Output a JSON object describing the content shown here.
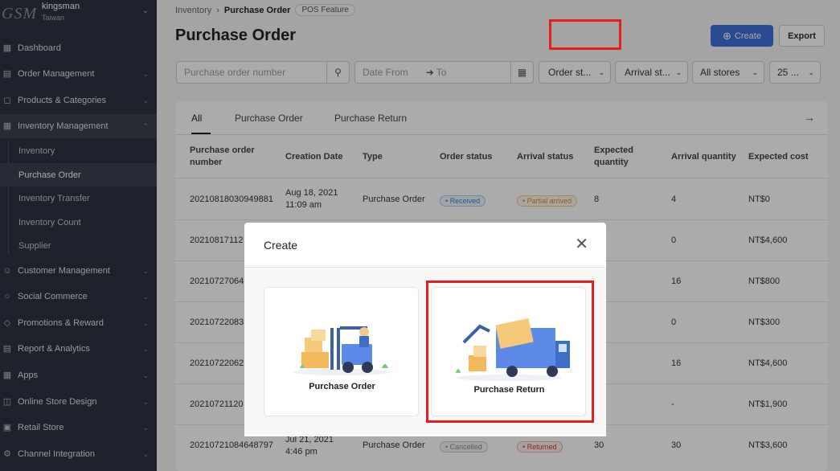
{
  "sidebar": {
    "logo": "GSM",
    "store_name": "kingsman",
    "region": "Taiwan",
    "items": [
      {
        "label": "Dashboard",
        "icon": "dashboard-icon"
      },
      {
        "label": "Order Management",
        "icon": "order-icon"
      },
      {
        "label": "Products & Categories",
        "icon": "product-icon"
      },
      {
        "label": "Inventory Management",
        "icon": "inventory-icon"
      },
      {
        "label": "Customer Management",
        "icon": "customer-icon"
      },
      {
        "label": "Social Commerce",
        "icon": "social-icon"
      },
      {
        "label": "Promotions & Reward",
        "icon": "promotion-icon"
      },
      {
        "label": "Report & Analytics",
        "icon": "report-icon"
      },
      {
        "label": "Apps",
        "icon": "apps-icon"
      },
      {
        "label": "Online Store Design",
        "icon": "design-icon"
      },
      {
        "label": "Retail Store",
        "icon": "store-icon"
      },
      {
        "label": "Channel Integration",
        "icon": "channel-icon"
      }
    ],
    "sub_items": [
      "Inventory",
      "Purchase Order",
      "Inventory Transfer",
      "Inventory Count",
      "Supplier"
    ]
  },
  "breadcrumb": {
    "parent": "Inventory",
    "current": "Purchase Order",
    "tag": "POS Feature"
  },
  "page_title": "Purchase Order",
  "actions": {
    "create_label": "Create",
    "export_label": "Export"
  },
  "filters": {
    "search_placeholder": "Purchase order number",
    "date_from": "Date From",
    "date_to": "To",
    "order_status": "Order st...",
    "arrival_status": "Arrival st...",
    "stores": "All stores",
    "per_page": "25 ..."
  },
  "tabs": [
    "All",
    "Purchase Order",
    "Purchase Return"
  ],
  "columns": [
    "Purchase order number",
    "Creation Date",
    "Type",
    "Order status",
    "Arrival status",
    "Expected quantity",
    "Arrival quantity",
    "Expected cost"
  ],
  "rows": [
    {
      "number": "20210818030949881",
      "date": "Aug 18, 2021",
      "time": "11:09 am",
      "type": "Purchase Order",
      "order_status": "Received",
      "arrival_status": "Partial arrived",
      "expected_qty": "8",
      "arrival_qty": "4",
      "cost": "NT$0"
    },
    {
      "number": "20210817112",
      "arrival_qty": "0",
      "cost": "NT$4,600"
    },
    {
      "number": "20210727064",
      "arrival_qty": "16",
      "cost": "NT$800"
    },
    {
      "number": "20210722083",
      "arrival_qty": "0",
      "cost": "NT$300"
    },
    {
      "number": "20210722062",
      "arrival_qty": "16",
      "cost": "NT$4,600"
    },
    {
      "number": "20210721120",
      "arrival_qty": "-",
      "cost": "NT$1,900"
    },
    {
      "number": "20210721084648797",
      "date": "Jul 21, 2021",
      "time": "4:46 pm",
      "type": "Purchase Order",
      "order_status": "Cancelled",
      "arrival_status": "Returned",
      "expected_qty": "30",
      "arrival_qty": "30",
      "cost": "NT$3,600"
    }
  ],
  "modal": {
    "title": "Create",
    "options": [
      {
        "label": "Purchase Order",
        "icon": "forklift-illustration"
      },
      {
        "label": "Purchase Return",
        "icon": "return-truck-illustration"
      }
    ]
  },
  "colors": {
    "primary": "#3d6fd9",
    "highlight": "#e0201a",
    "sidebar_bg": "#2e3240"
  }
}
